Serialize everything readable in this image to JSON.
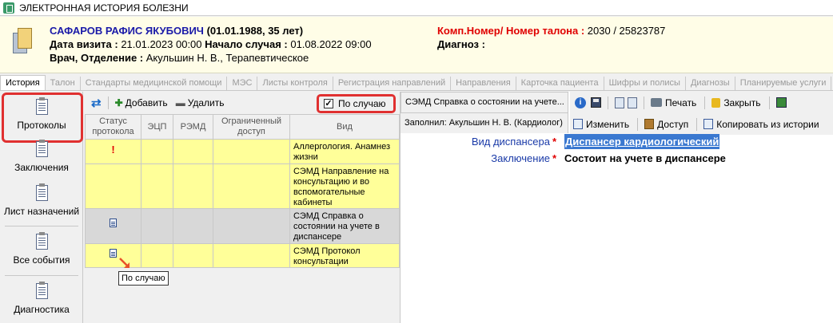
{
  "window": {
    "title": "ЭЛЕКТРОННАЯ ИСТОРИЯ БОЛЕЗНИ"
  },
  "patient": {
    "name": "САФАРОВ РАФИС ЯКУБОВИЧ",
    "dob_age": "(01.01.1988, 35 лет)",
    "visit_label": "Дата визита :",
    "visit_value": "21.01.2023 00:00",
    "case_label": "Начало случая :",
    "case_value": "01.08.2022 09:00",
    "doctor_label": "Врач, Отделение :",
    "doctor_value": "Акульшин Н. В., Терапевтическое",
    "comp_label": "Комп.Номер/ Номер талона :",
    "comp_value": "2030 / 25823787",
    "diag_label": "Диагноз :"
  },
  "tabs": [
    "История",
    "Талон",
    "Стандарты медицинской помощи",
    "МЭС",
    "Листы контроля",
    "Регистрация направлений",
    "Направления",
    "Карточка пациента",
    "Шифры и полисы",
    "Диагнозы",
    "Планируемые услуги"
  ],
  "sidebar": {
    "items": [
      "Протоколы",
      "Заключения",
      "Лист назначений",
      "Все события",
      "Диагностика"
    ]
  },
  "middle_toolbar": {
    "add": "Добавить",
    "delete": "Удалить",
    "by_case": "По случаю",
    "by_case_checked": true
  },
  "grid": {
    "headers": [
      "Статус протокола",
      "ЭЦП",
      "РЭМД",
      "Ограниченный доступ",
      "Вид"
    ],
    "rows": [
      {
        "status": "exclamation-icon",
        "kind": "Аллергология. Анамнез жизни"
      },
      {
        "status": "",
        "kind": "СЭМД Направление на консультацию и во вспомогательные кабинеты"
      },
      {
        "status": "document-icon",
        "kind": "СЭМД Справка о состоянии на учете в диспансере"
      },
      {
        "status": "document-icon",
        "kind": "СЭМД Протокол консультации"
      }
    ],
    "tooltip": "По случаю"
  },
  "right_panel": {
    "doc_tab": "СЭМД Справка о состоянии на учете...",
    "filled_by": "Заполнил: Акульшин Н. В. (Кардиолог)",
    "print": "Печать",
    "close": "Закрыть",
    "edit": "Изменить",
    "access": "Доступ",
    "copy_history": "Копировать из истории",
    "fields": [
      {
        "label": "Вид диспансера",
        "value": "Диспансер кардиологический"
      },
      {
        "label": "Заключение",
        "value": "Состоит на учете в диспансере"
      }
    ],
    "required_mark": "*"
  }
}
